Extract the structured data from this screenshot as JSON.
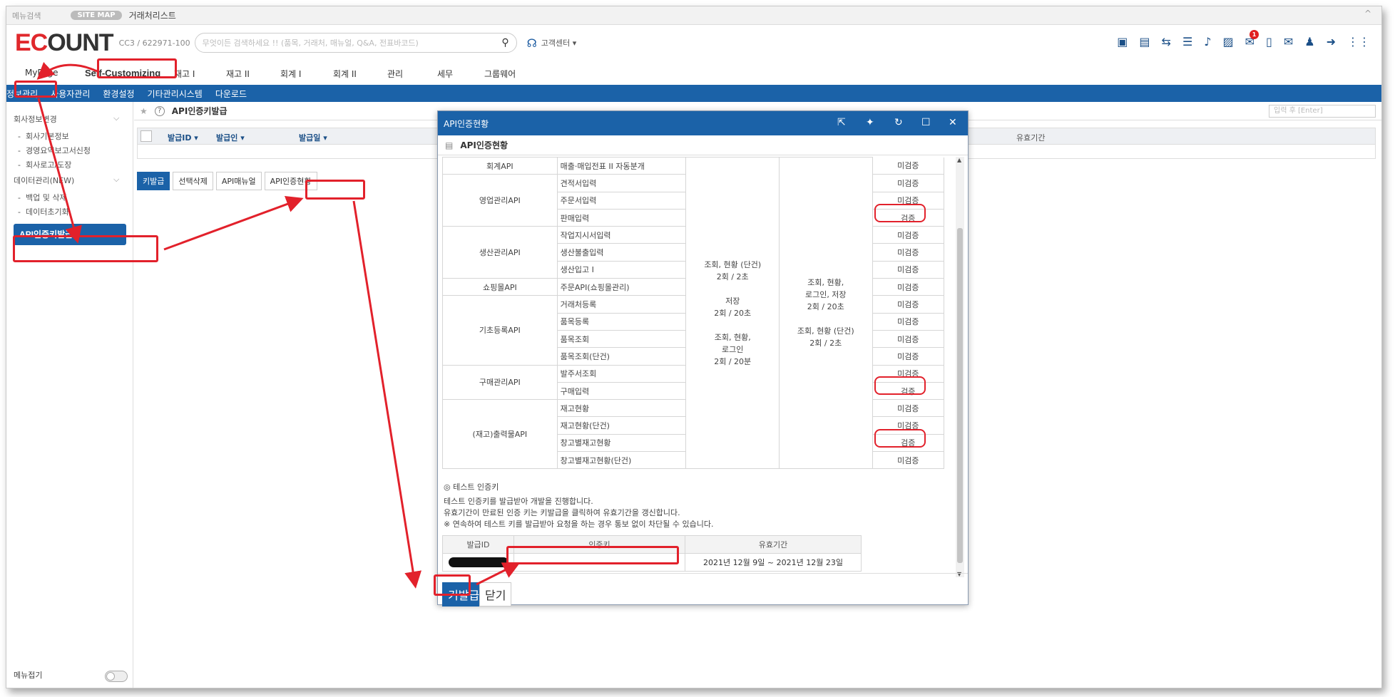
{
  "topbar": {
    "menu_search": "메뉴검색",
    "sitemap": "SITE MAP",
    "title": "거래처리스트",
    "up": "^"
  },
  "header": {
    "logo_ec": "EC",
    "logo_rest": "OUNT",
    "company": "CC3 / 622971-100",
    "search_placeholder": "무엇이든 검색하세요 !! (품목, 거래처, 매뉴얼, Q&A, 전표바코드)",
    "customer_center": "고객센터 ▾",
    "notification_count": "1"
  },
  "tabs": [
    "MyPage",
    "Self-Customizing",
    "재고 I",
    "재고 II",
    "회계 I",
    "회계 II",
    "관리",
    "세무",
    "그룹웨어"
  ],
  "subnav": [
    "정보관리",
    "사용자관리",
    "환경설정",
    "기타관리시스템",
    "다운로드"
  ],
  "sidebar": {
    "group1": "회사정보변경",
    "group1_items": [
      "회사기본정보",
      "경영요약보고서신청",
      "회사로고/도장"
    ],
    "group2": "데이터관리(NEW)",
    "group2_items": [
      "백업 및 삭제",
      "데이터초기화"
    ],
    "active": "API인증키발급",
    "fold_label": "메뉴접기"
  },
  "main": {
    "title": "API인증키발급",
    "filter_placeholder": "입력 후 [Enter]",
    "columns": [
      "발급ID ▾",
      "발급인 ▾",
      "발급일 ▾",
      "유효기간"
    ],
    "buttons": [
      "키발급",
      "선택삭제",
      "API매뉴얼",
      "API인증현황"
    ]
  },
  "modal": {
    "title": "API인증현황",
    "subtitle": "API인증현황",
    "rows": [
      {
        "group": "회계API",
        "api": "매출·매입전표 II 자동분개",
        "status": "미검증"
      },
      {
        "group": "영업관리API",
        "api": "견적서입력",
        "status": "미검증"
      },
      {
        "group": "",
        "api": "주문서입력",
        "status": "미검증"
      },
      {
        "group": "",
        "api": "판매입력",
        "status": "검증"
      },
      {
        "group": "생산관리API",
        "api": "작업지시서입력",
        "status": "미검증"
      },
      {
        "group": "",
        "api": "생산불출입력",
        "status": "미검증"
      },
      {
        "group": "",
        "api": "생산입고 I",
        "status": "미검증"
      },
      {
        "group": "쇼핑몰API",
        "api": "주문API(쇼핑몰관리)",
        "status": "미검증"
      },
      {
        "group": "기초등록API",
        "api": "거래처등록",
        "status": "미검증"
      },
      {
        "group": "",
        "api": "품목등록",
        "status": "미검증"
      },
      {
        "group": "",
        "api": "품목조회",
        "status": "미검증"
      },
      {
        "group": "",
        "api": "품목조회(단건)",
        "status": "미검증"
      },
      {
        "group": "구매관리API",
        "api": "발주서조회",
        "status": "미검증"
      },
      {
        "group": "",
        "api": "구매입력",
        "status": "검증"
      },
      {
        "group": "(재고)출력물API",
        "api": "재고현황",
        "status": "미검증"
      },
      {
        "group": "",
        "api": "재고현황(단건)",
        "status": "미검증"
      },
      {
        "group": "",
        "api": "창고별재고현황",
        "status": "검증"
      },
      {
        "group": "",
        "api": "창고별재고현황(단건)",
        "status": "미검증"
      }
    ],
    "limits_col1": [
      "조회, 현황 (단건)",
      "2회 / 2초",
      "",
      "저장",
      "2회 / 20초",
      "",
      "조회, 현황,",
      "로그인",
      "2회 / 20분"
    ],
    "limits_col2": [
      "조회, 현황,",
      "로그인, 저장",
      "2회 / 20초",
      "",
      "조회, 현황 (단건)",
      "2회 / 2초"
    ],
    "test_key_title": "◎ 테스트 인증키",
    "test_key_lines": [
      "테스트 인증키를 발급받아 개발을 진행합니다.",
      "유효기간이 만료된 인증 키는 키발급을 클릭하여 유효기간을 갱신합니다.",
      "※ 연속하여 테스트 키를 발급받아 요청을 하는 경우 통보 없이 차단될 수 있습니다."
    ],
    "key_table_headers": [
      "발급ID",
      "인증키",
      "유효기간"
    ],
    "key_row_validity": "2021년 12월 9일 ~ 2021년 12월 23일",
    "footer_buttons": [
      "키발급",
      "닫기"
    ]
  },
  "colors": {
    "brand_blue": "#1b62a8",
    "logo_red": "#e0282c",
    "annotation_red": "#e2212b"
  }
}
